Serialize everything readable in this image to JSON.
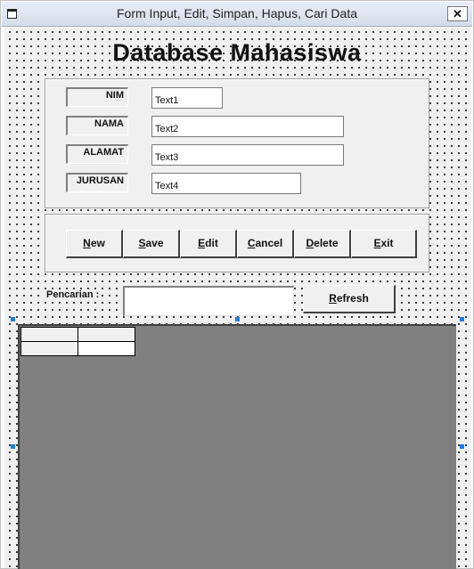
{
  "window": {
    "title": "Form Input, Edit, Simpan, Hapus, Cari Data",
    "close_label": "✕"
  },
  "heading": "Database Mahasiswa",
  "fields": [
    {
      "label": "NIM",
      "value": "Text1"
    },
    {
      "label": "NAMA",
      "value": "Text2"
    },
    {
      "label": "ALAMAT",
      "value": "Text3"
    },
    {
      "label": "JURUSAN",
      "value": "Text4"
    }
  ],
  "buttons": [
    {
      "key": "N",
      "rest": "ew"
    },
    {
      "key": "S",
      "rest": "ave"
    },
    {
      "key": "E",
      "rest": "dit"
    },
    {
      "key": "C",
      "rest": "ancel"
    },
    {
      "key": "D",
      "rest": "elete"
    },
    {
      "key": "E",
      "rest": "xit"
    }
  ],
  "search": {
    "label": "Pencarian  :",
    "value": "",
    "refresh_key": "R",
    "refresh_rest": "efresh"
  },
  "colors": {
    "form_bg": "#f0f0f0",
    "grid_bg": "#808080",
    "selection_handle": "#1a7fe8"
  }
}
